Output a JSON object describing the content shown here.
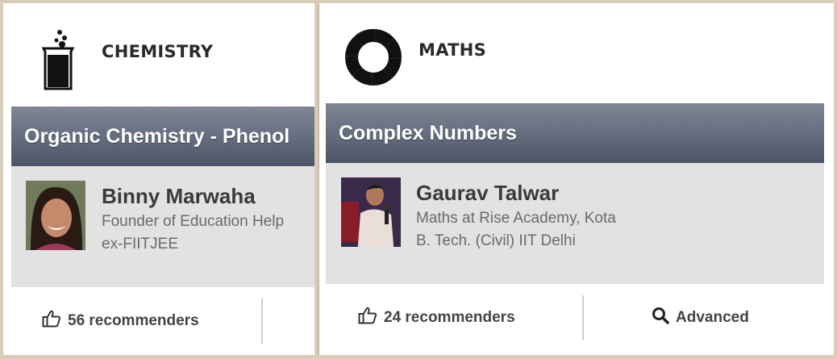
{
  "cards": [
    {
      "subject": "CHEMISTRY",
      "topic": "Organic Chemistry - Phenol",
      "author": {
        "name": "Binny Marwaha",
        "line1": "Founder of Education Help",
        "line2": "ex-FIITJEE"
      },
      "recommenders": "56 recommenders"
    },
    {
      "subject": "MATHS",
      "topic": "Complex Numbers",
      "author": {
        "name": "Gaurav  Talwar",
        "line1": "Maths at Rise Academy, Kota",
        "line2": "B. Tech. (Civil) IIT Delhi"
      },
      "recommenders": "24 recommenders",
      "extra_action": "Advanced"
    }
  ],
  "icons": {
    "chemistry": "beaker-icon",
    "maths": "segmented-ring-icon",
    "recommend": "thumbs-up-icon",
    "advanced": "search-icon"
  },
  "colors": {
    "topic_bar_top": "#7f8797",
    "topic_bar_bottom": "#4c5566",
    "author_bg": "#e2e2e2",
    "frame": "#d9cdb8"
  }
}
